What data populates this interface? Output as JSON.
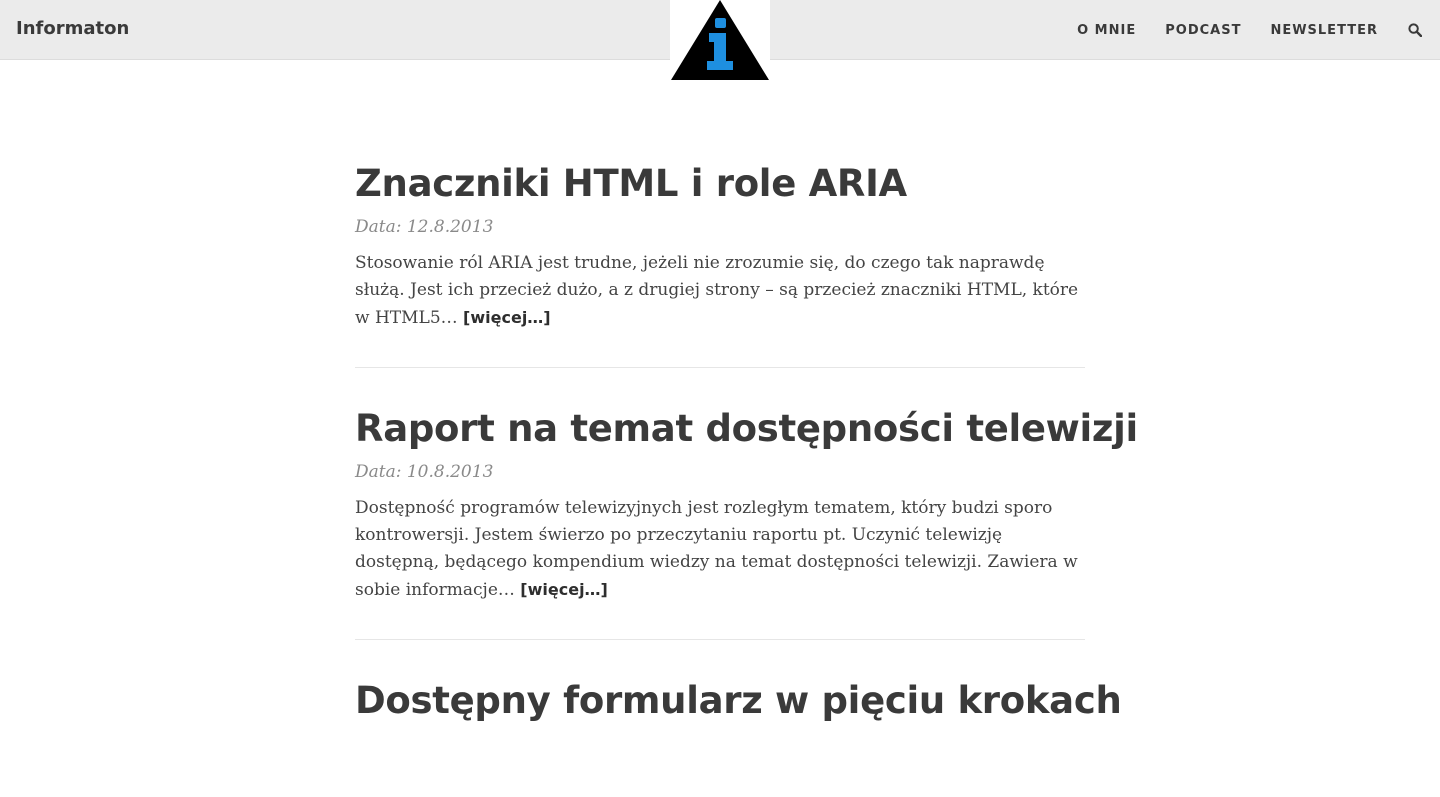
{
  "header": {
    "brand": "Informaton",
    "logo_icon": "info-triangle-logo-icon",
    "nav": [
      "O MNIE",
      "PODCAST",
      "NEWSLETTER"
    ],
    "search_icon": "search-icon"
  },
  "posts": [
    {
      "title": "Znaczniki HTML i role ARIA",
      "date": "Data: 12.8.2013",
      "excerpt": "Stosowanie ról ARIA jest trudne, jeżeli nie zrozumie się, do czego tak naprawdę służą. Jest ich przecież dużo, a z drugiej strony – są przecież znaczniki HTML, które w HTML5…",
      "more": "[więcej…]"
    },
    {
      "title": "Raport na temat dostępności telewizji",
      "date": "Data: 10.8.2013",
      "excerpt": "Dostępność programów telewizyjnych jest rozległym tematem, który budzi sporo kontrowersji. Jestem świerzo po przeczytaniu raportu pt. Uczynić telewizję dostępną, będącego kompendium wiedzy na temat dostępności telewizji. Zawiera w sobie informacje…",
      "more": "[więcej…]"
    },
    {
      "title": "Dostępny formularz w pięciu krokach"
    }
  ],
  "colors": {
    "header_bg": "#ebebeb",
    "text": "#3a3a3a",
    "date": "#8a8a8a",
    "logo_triangle": "#000000",
    "logo_glyph": "#1e8fe0"
  }
}
